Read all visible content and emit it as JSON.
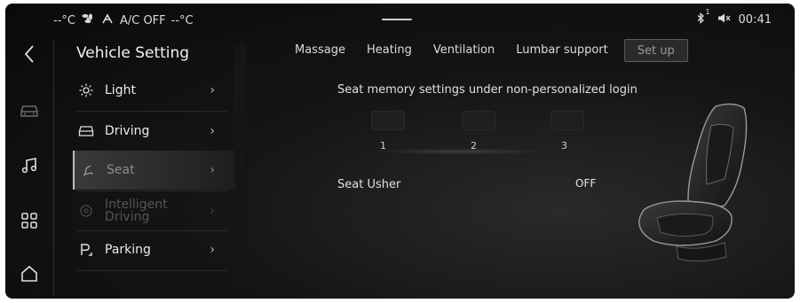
{
  "status_bar": {
    "left_temp": "--°C",
    "ac_status": "A/C OFF",
    "right_temp": "--°C",
    "bluetooth_badge": "1",
    "time": "00:41"
  },
  "panel": {
    "title": "Vehicle Setting",
    "items": [
      {
        "label": "Light",
        "icon": "sun-icon"
      },
      {
        "label": "Driving",
        "icon": "car-icon"
      },
      {
        "label": "Seat",
        "icon": "seat-icon"
      },
      {
        "label": "Intelligent Driving",
        "icon": "target-icon"
      },
      {
        "label": "Parking",
        "icon": "parking-icon"
      }
    ]
  },
  "tabs": [
    {
      "label": "Massage"
    },
    {
      "label": "Heating"
    },
    {
      "label": "Ventilation"
    },
    {
      "label": "Lumbar support"
    },
    {
      "label": "Set up"
    }
  ],
  "main": {
    "memory_heading": "Seat memory settings under non-personalized login",
    "memory_slots": [
      {
        "number": "1"
      },
      {
        "number": "2"
      },
      {
        "number": "3"
      }
    ],
    "usher_label": "Seat Usher",
    "usher_value": "OFF"
  },
  "rail": [
    "back-icon",
    "car-icon",
    "music-icon",
    "apps-icon",
    "home-icon"
  ],
  "colors": {
    "background": "#0f0f0f",
    "text": "#e6e6e6",
    "active_tab_bg": "#2a2a2a"
  }
}
